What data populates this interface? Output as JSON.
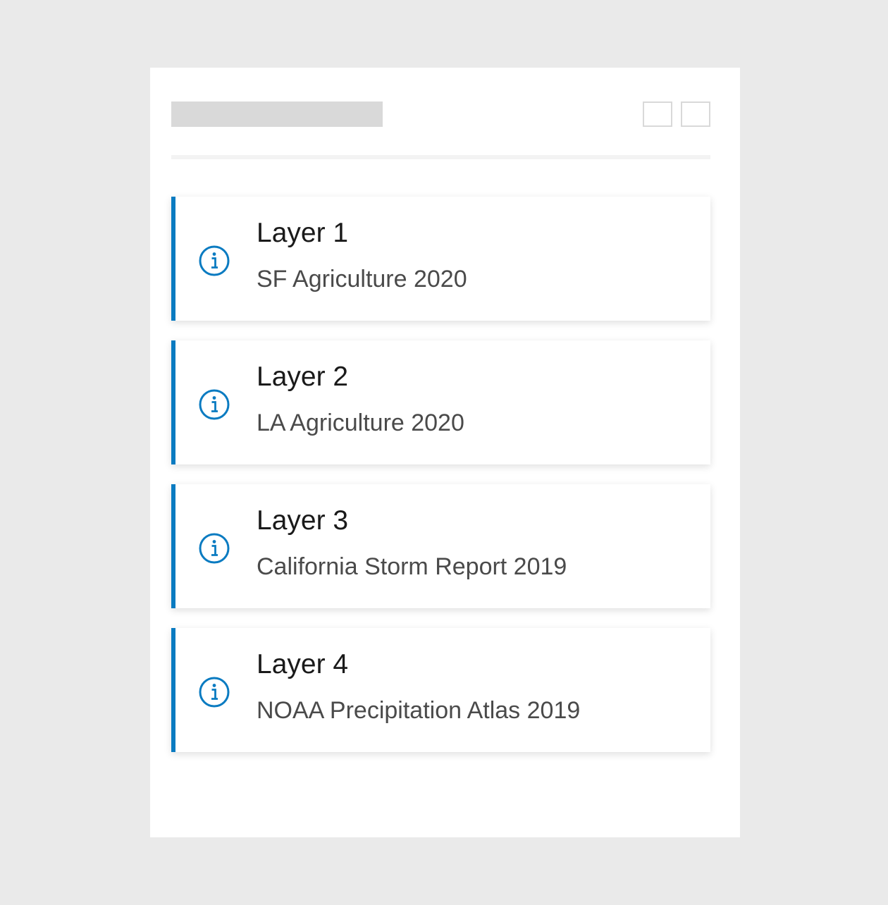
{
  "colors": {
    "background": "#eaeaea",
    "panel": "#ffffff",
    "placeholder": "#d9d9d9",
    "accent": "#0a7bc1",
    "title_text": "#1a1a1a",
    "subtitle_text": "#4a4a4a"
  },
  "header": {
    "buttons": [
      {
        "icon": "square-button"
      },
      {
        "icon": "square-button"
      }
    ]
  },
  "layers": [
    {
      "title": "Layer 1",
      "subtitle": "SF Agriculture 2020",
      "icon": "info-icon"
    },
    {
      "title": "Layer 2",
      "subtitle": "LA Agriculture 2020",
      "icon": "info-icon"
    },
    {
      "title": "Layer 3",
      "subtitle": "California Storm Report 2019",
      "icon": "info-icon"
    },
    {
      "title": "Layer 4",
      "subtitle": "NOAA Precipitation Atlas 2019",
      "icon": "info-icon"
    }
  ]
}
